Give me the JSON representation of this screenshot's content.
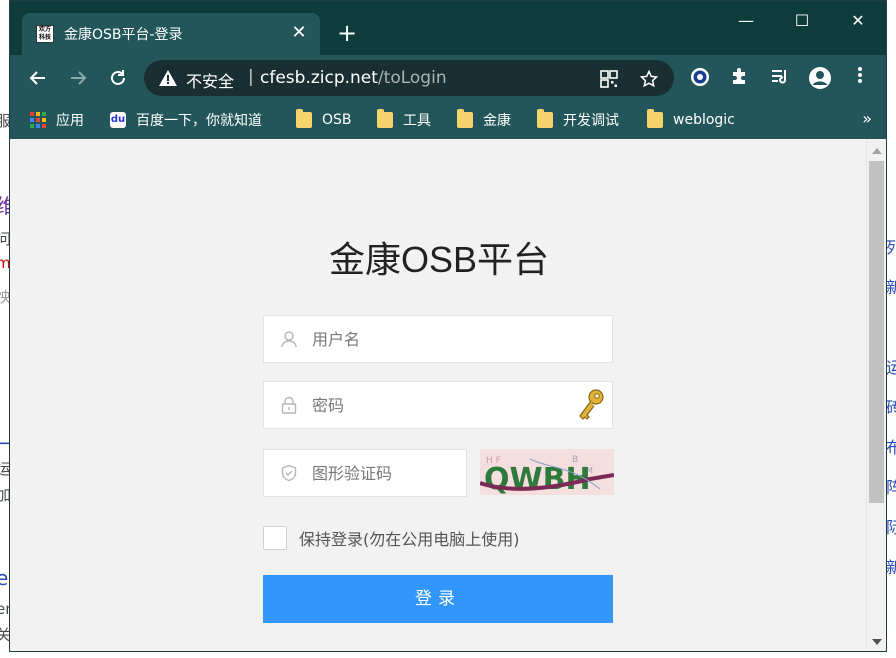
{
  "browser": {
    "tab": {
      "favicon_text": "欢方科技",
      "title": "金康OSB平台-登录",
      "close": "✕"
    },
    "new_tab": "+",
    "window_controls": {
      "minimize": "—",
      "maximize": "☐",
      "close": "✕"
    },
    "address_bar": {
      "security_label": "不安全",
      "separator": "|",
      "host": "cfesb.zicp.net",
      "path": "/toLogin"
    },
    "bookmarks": [
      {
        "label": "应用",
        "icon": "apps-grid-icon"
      },
      {
        "label": "百度一下，你就知道",
        "icon": "baidu-icon"
      },
      {
        "label": "OSB",
        "icon": "folder-icon"
      },
      {
        "label": "工具",
        "icon": "folder-icon"
      },
      {
        "label": "金康",
        "icon": "folder-icon"
      },
      {
        "label": "开发调试",
        "icon": "folder-icon"
      },
      {
        "label": "weblogic",
        "icon": "folder-icon"
      }
    ],
    "bookmarks_more": "»"
  },
  "login": {
    "title": "金康OSB平台",
    "username_placeholder": "用户名",
    "password_placeholder": "密码",
    "captcha_placeholder": "图形验证码",
    "captcha_text": "QWBH",
    "remember_label": "保持登录(勿在公用电脑上使用)",
    "submit_label": "登录"
  },
  "colors": {
    "titlebar": "#0d3c3b",
    "toolbar": "#23565a",
    "primary_button": "#3296fa",
    "page_background": "#f2f2f2"
  }
}
